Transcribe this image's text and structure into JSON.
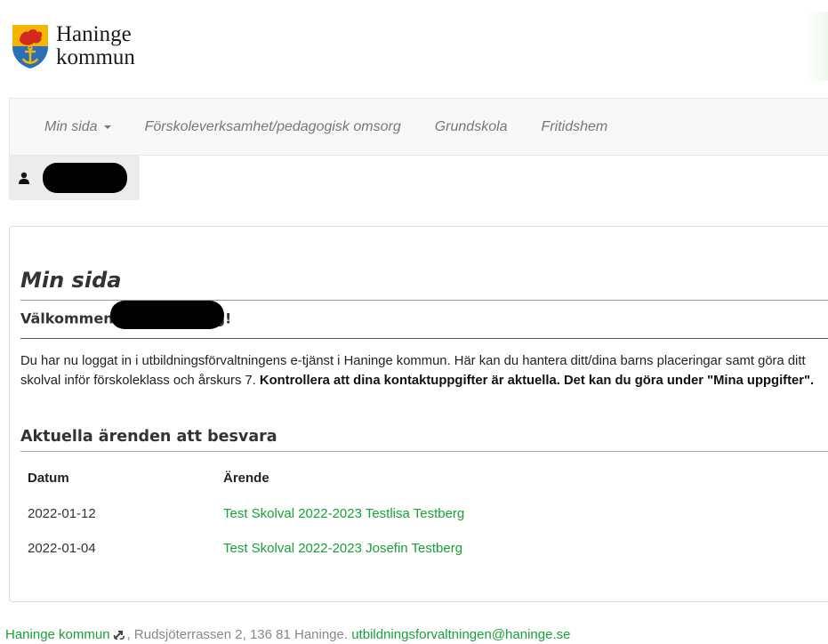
{
  "logo": {
    "line1": "Haninge",
    "line2": "kommun"
  },
  "nav": {
    "items": [
      {
        "label": "Min sida",
        "has_caret": true
      },
      {
        "label": "Förskoleverksamhet/pedagogisk omsorg"
      },
      {
        "label": "Grundskola"
      },
      {
        "label": "Fritidshem"
      }
    ]
  },
  "user": {
    "icon": "user-icon",
    "name": ""
  },
  "main": {
    "title": "Min sida",
    "welcome_prefix": "Välkommen",
    "welcome_suffix": "g!",
    "intro_text": "Du har nu loggat in i utbildningsförvaltningens e-tjänst i Haninge kommun. Här kan du hantera ditt/dina barns placeringar samt göra ditt skolval inför förskoleklass och årskurs 7. ",
    "intro_bold": "Kontrollera att dina kontaktuppgifter är aktuella. Det kan du göra under \"Mina uppgifter\".",
    "section_title": "Aktuella ärenden att besvara",
    "table": {
      "headers": {
        "date": "Datum",
        "case": "Ärende"
      },
      "rows": [
        {
          "date": "2022-01-12",
          "case": "Test Skolval 2022-2023 Testlisa Testberg"
        },
        {
          "date": "2022-01-04",
          "case": "Test Skolval 2022-2023 Josefin Testberg"
        }
      ]
    }
  },
  "footer": {
    "org_link": "Haninge kommun",
    "address": ", Rudsjöterrassen 2, 136 81 Haninge. ",
    "email": "utbildningsforvaltningen@haninge.se"
  },
  "colors": {
    "link": "#18a038",
    "nav_text": "#777777",
    "navbar_bg": "#f8f8f8"
  }
}
